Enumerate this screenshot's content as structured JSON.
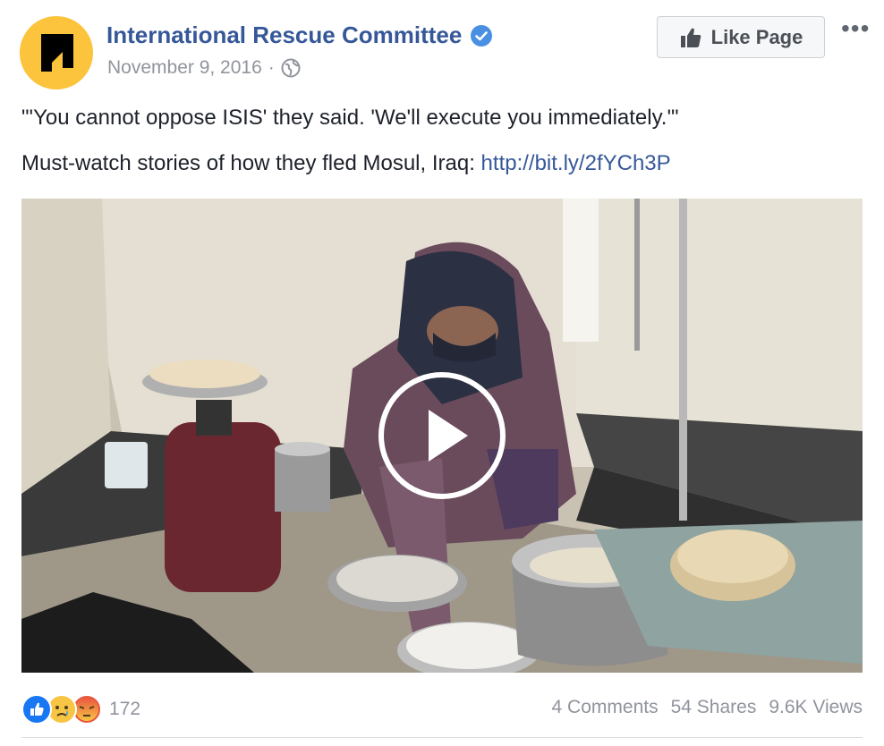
{
  "post": {
    "page_name": "International Rescue Committee",
    "date": "November 9, 2016",
    "separator": "·",
    "privacy_icon": "globe-icon",
    "like_button": "Like Page",
    "more_label": "•••",
    "line1": "\"'You cannot oppose ISIS' they said. 'We'll execute you immediately.'\"",
    "line2": "Must-watch stories of how they fled Mosul, Iraq:",
    "link": "http://bit.ly/2fYCh3P"
  },
  "reactions": {
    "icons": [
      "like-icon",
      "sad-icon",
      "angry-icon"
    ],
    "count": "172"
  },
  "stats": {
    "comments": "4 Comments",
    "shares": "54 Shares",
    "views": "9.6K Views"
  },
  "colors": {
    "link": "#365899",
    "brand_yellow": "#fcc33c",
    "like_blue": "#1877f2",
    "angry_red": "#e9573f",
    "sad_yellow": "#f7c544"
  }
}
